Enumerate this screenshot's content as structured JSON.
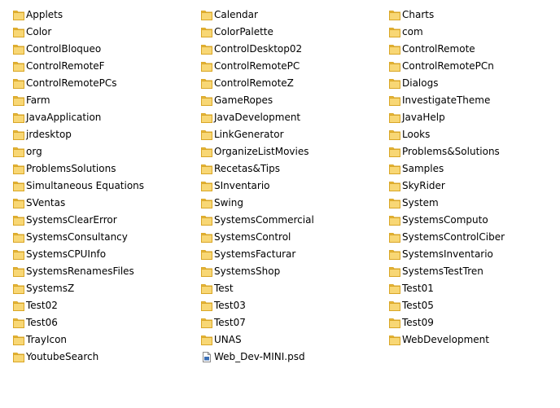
{
  "folder_view": {
    "items": [
      {
        "name": "Applets",
        "icon": "folder-icon"
      },
      {
        "name": "Color",
        "icon": "folder-icon"
      },
      {
        "name": "ControlBloqueo",
        "icon": "folder-icon"
      },
      {
        "name": "ControlRemoteF",
        "icon": "folder-icon"
      },
      {
        "name": "ControlRemotePCs",
        "icon": "folder-icon"
      },
      {
        "name": "Farm",
        "icon": "folder-icon"
      },
      {
        "name": "JavaApplication",
        "icon": "folder-icon"
      },
      {
        "name": "jrdesktop",
        "icon": "folder-icon"
      },
      {
        "name": "org",
        "icon": "folder-icon"
      },
      {
        "name": "ProblemsSolutions",
        "icon": "folder-icon"
      },
      {
        "name": "Simultaneous Equations",
        "icon": "folder-icon"
      },
      {
        "name": "SVentas",
        "icon": "folder-icon"
      },
      {
        "name": "SystemsClearError",
        "icon": "folder-icon"
      },
      {
        "name": "SystemsConsultancy",
        "icon": "folder-icon"
      },
      {
        "name": "SystemsCPUInfo",
        "icon": "folder-icon"
      },
      {
        "name": "SystemsRenamesFiles",
        "icon": "folder-icon"
      },
      {
        "name": "SystemsZ",
        "icon": "folder-icon"
      },
      {
        "name": "Test02",
        "icon": "folder-icon"
      },
      {
        "name": "Test06",
        "icon": "folder-icon"
      },
      {
        "name": "TrayIcon",
        "icon": "folder-icon"
      },
      {
        "name": "YoutubeSearch",
        "icon": "folder-icon"
      },
      {
        "name": "Calendar",
        "icon": "folder-icon"
      },
      {
        "name": "ColorPalette",
        "icon": "folder-icon"
      },
      {
        "name": "ControlDesktop02",
        "icon": "folder-icon"
      },
      {
        "name": "ControlRemotePC",
        "icon": "folder-icon"
      },
      {
        "name": "ControlRemoteZ",
        "icon": "folder-icon"
      },
      {
        "name": "GameRopes",
        "icon": "folder-icon"
      },
      {
        "name": "JavaDevelopment",
        "icon": "folder-icon"
      },
      {
        "name": "LinkGenerator",
        "icon": "folder-icon"
      },
      {
        "name": "OrganizeListMovies",
        "icon": "folder-icon"
      },
      {
        "name": "Recetas&Tips",
        "icon": "folder-icon"
      },
      {
        "name": "SInventario",
        "icon": "folder-icon"
      },
      {
        "name": "Swing",
        "icon": "folder-icon"
      },
      {
        "name": "SystemsCommercial",
        "icon": "folder-icon"
      },
      {
        "name": "SystemsControl",
        "icon": "folder-icon"
      },
      {
        "name": "SystemsFacturar",
        "icon": "folder-icon"
      },
      {
        "name": "SystemsShop",
        "icon": "folder-icon"
      },
      {
        "name": "Test",
        "icon": "folder-icon"
      },
      {
        "name": "Test03",
        "icon": "folder-icon"
      },
      {
        "name": "Test07",
        "icon": "folder-icon"
      },
      {
        "name": "UNAS",
        "icon": "folder-icon"
      },
      {
        "name": "Web_Dev-MINI.psd",
        "icon": "psd-file-icon"
      },
      {
        "name": "Charts",
        "icon": "folder-icon"
      },
      {
        "name": "com",
        "icon": "folder-icon"
      },
      {
        "name": "ControlRemote",
        "icon": "folder-icon"
      },
      {
        "name": "ControlRemotePCn",
        "icon": "folder-icon"
      },
      {
        "name": "Dialogs",
        "icon": "folder-icon"
      },
      {
        "name": "InvestigateTheme",
        "icon": "folder-icon"
      },
      {
        "name": "JavaHelp",
        "icon": "folder-icon"
      },
      {
        "name": "Looks",
        "icon": "folder-icon"
      },
      {
        "name": "Problems&Solutions",
        "icon": "folder-icon"
      },
      {
        "name": "Samples",
        "icon": "folder-icon"
      },
      {
        "name": "SkyRider",
        "icon": "folder-icon"
      },
      {
        "name": "System",
        "icon": "folder-icon"
      },
      {
        "name": "SystemsComputo",
        "icon": "folder-icon"
      },
      {
        "name": "SystemsControlCiber",
        "icon": "folder-icon"
      },
      {
        "name": "SystemsInventario",
        "icon": "folder-icon"
      },
      {
        "name": "SystemsTestTren",
        "icon": "folder-icon"
      },
      {
        "name": "Test01",
        "icon": "folder-icon"
      },
      {
        "name": "Test05",
        "icon": "folder-icon"
      },
      {
        "name": "Test09",
        "icon": "folder-icon"
      },
      {
        "name": "WebDevelopment",
        "icon": "folder-icon"
      }
    ]
  },
  "colors": {
    "folder_fill": "#f8d775",
    "folder_tab": "#e8b83a",
    "folder_edge": "#d9a626",
    "file_fill": "#ffffff",
    "file_edge": "#8a8a8a",
    "text": "#000000",
    "background": "#ffffff"
  }
}
